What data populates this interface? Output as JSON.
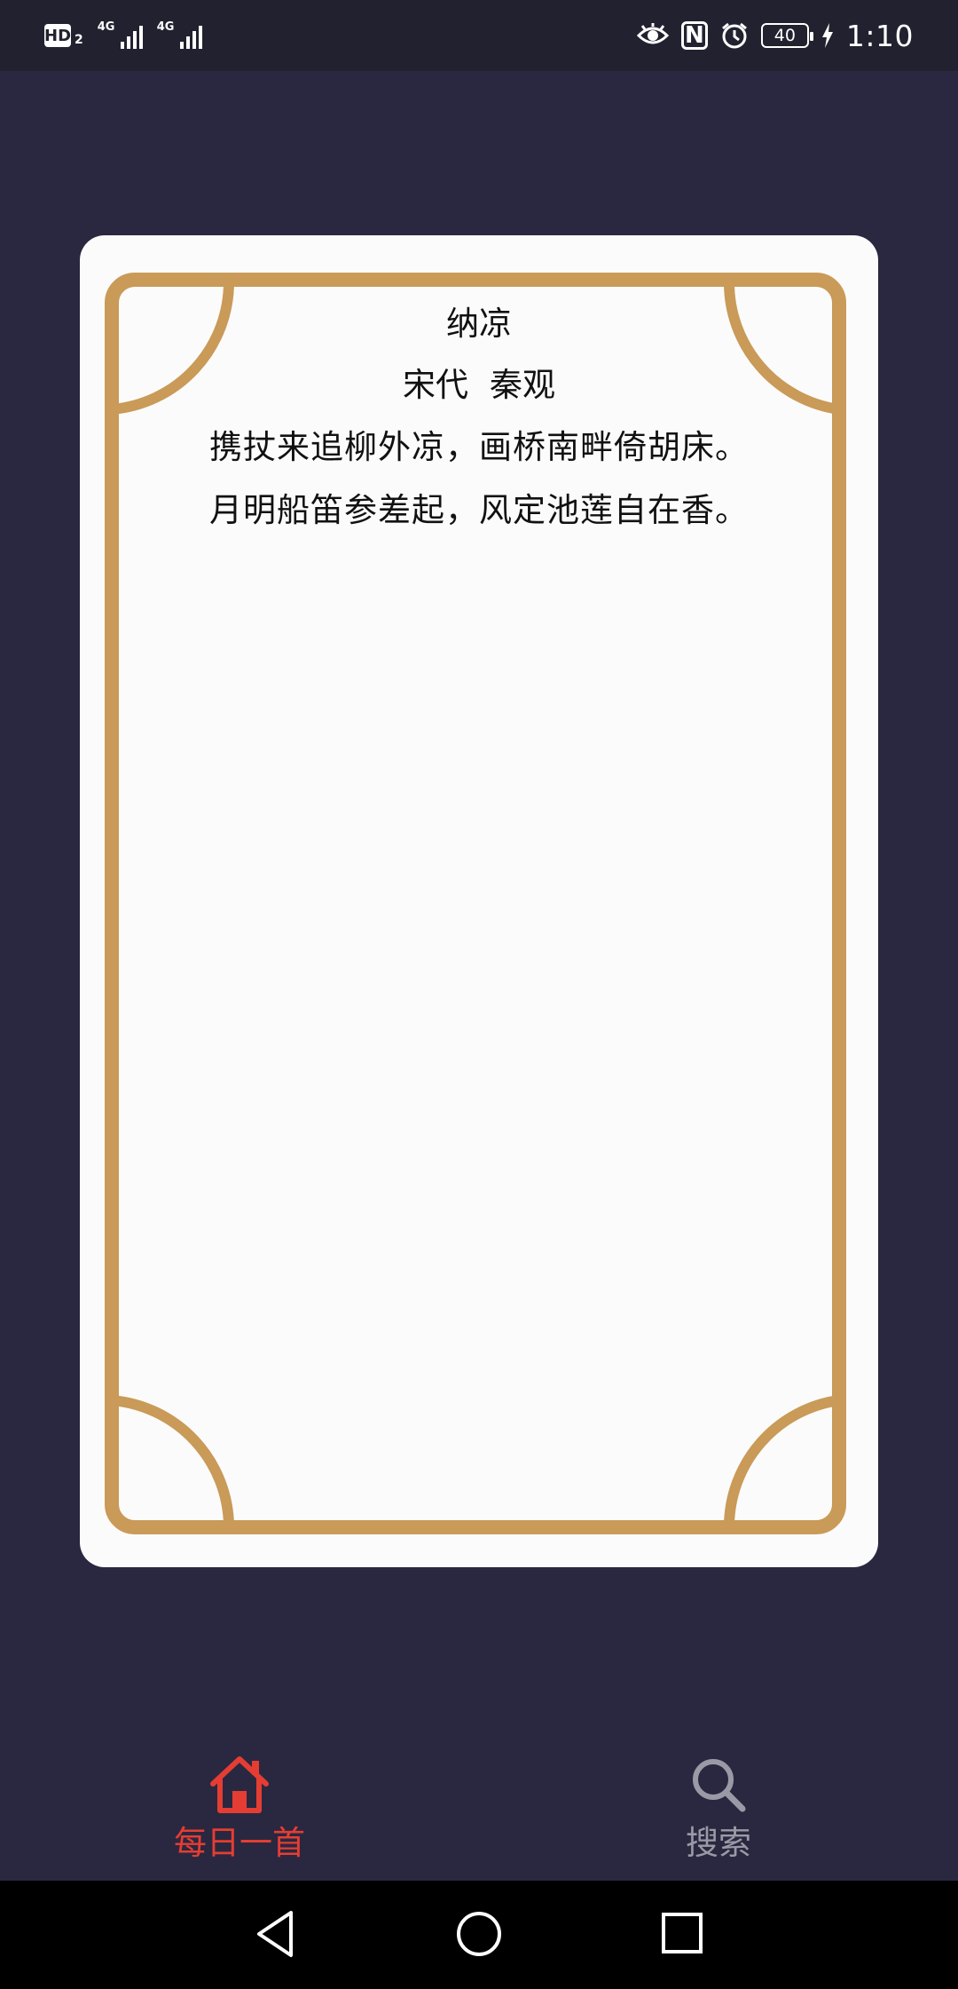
{
  "status_bar": {
    "hd_label": "HD",
    "hd_sub": "2",
    "network_1": "4G",
    "network_2": "4G",
    "battery": "40",
    "time": "1:10",
    "nfc_label": "N",
    "icons": [
      "eye-icon",
      "nfc-icon",
      "alarm-icon",
      "battery-icon",
      "charging-icon"
    ]
  },
  "poem": {
    "title": "纳凉",
    "dynasty": "宋代",
    "author": "秦观",
    "lines": [
      "携扙来追柳外凉，画桥南畔倚胡床。",
      "月明船笛参差起，风定池莲自在香。"
    ]
  },
  "tabs": [
    {
      "label": "每日一首",
      "icon": "home-icon",
      "active": true
    },
    {
      "label": "搜索",
      "icon": "search-icon",
      "active": false
    }
  ],
  "nav": {
    "icons": [
      "back-icon",
      "home-circle-icon",
      "recents-icon"
    ]
  },
  "colors": {
    "background": "#292840",
    "card": "#fcfbfb",
    "frame": "#c99a58",
    "active_tab": "#e53d33",
    "inactive_tab": "#9a9aa6"
  }
}
